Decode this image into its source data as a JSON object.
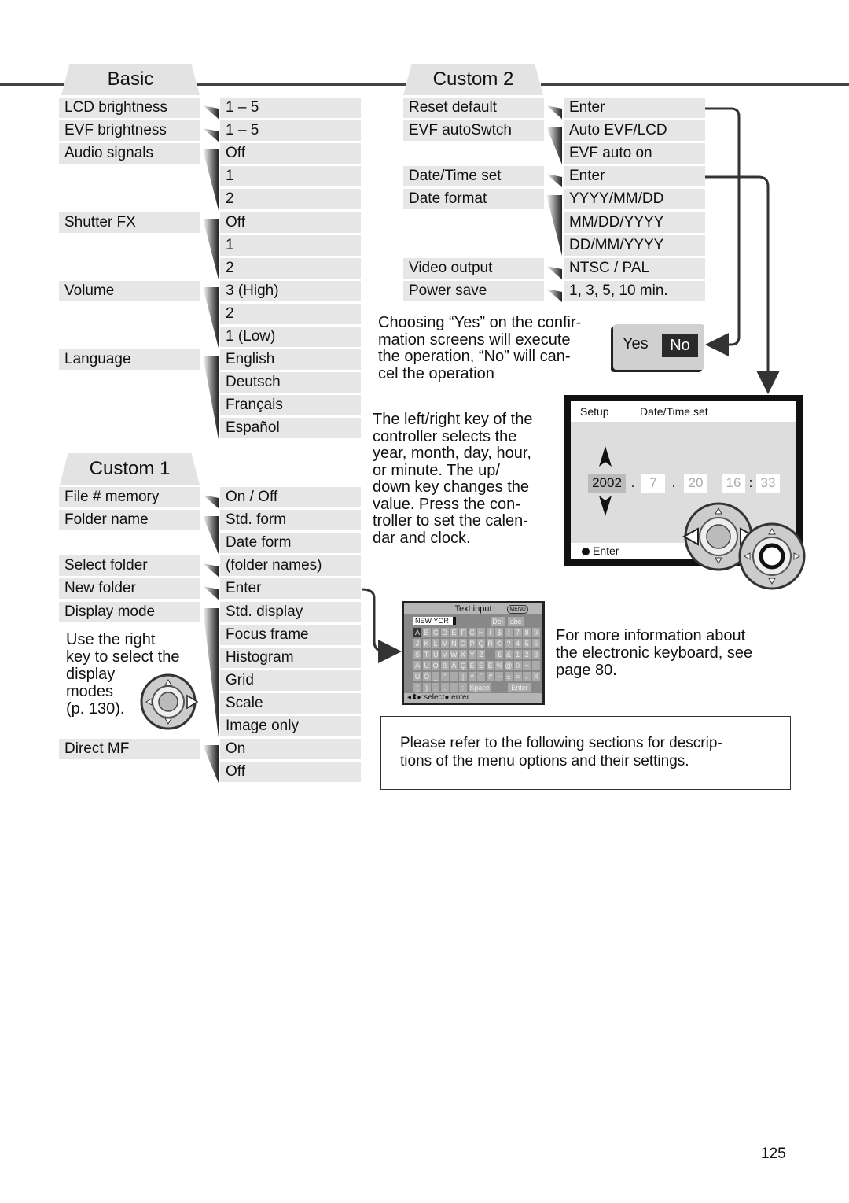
{
  "page_number": "125",
  "basic": {
    "title": "Basic",
    "groups": [
      {
        "label": "LCD brightness",
        "options": [
          "1 – 5"
        ]
      },
      {
        "label": "EVF brightness",
        "options": [
          "1 – 5"
        ]
      },
      {
        "label": "Audio signals",
        "options": [
          "Off",
          "1",
          "2"
        ]
      },
      {
        "label": "Shutter FX",
        "options": [
          "Off",
          "1",
          "2"
        ]
      },
      {
        "label": "Volume",
        "options": [
          "3 (High)",
          "2",
          "1 (Low)"
        ]
      },
      {
        "label": "Language",
        "options": [
          "English",
          "Deutsch",
          "Français",
          "Español"
        ]
      }
    ]
  },
  "custom1": {
    "title": "Custom 1",
    "groups": [
      {
        "label": "File # memory",
        "options": [
          "On / Off"
        ]
      },
      {
        "label": "Folder name",
        "options": [
          "Std. form",
          "Date form"
        ]
      },
      {
        "label": "Select folder",
        "options": [
          "(folder names)"
        ]
      },
      {
        "label": "New folder",
        "options": [
          "Enter"
        ]
      },
      {
        "label": "Display mode",
        "options": [
          "Std. display",
          "Focus frame",
          "Histogram",
          "Grid",
          "Scale",
          "Image only"
        ]
      },
      {
        "label": "Direct MF",
        "options": [
          "On",
          "Off"
        ]
      }
    ],
    "display_mode_note": "Use the right\nkey to select the\ndisplay\nmodes\n(p. 130)."
  },
  "custom2": {
    "title": "Custom 2",
    "groups": [
      {
        "label": "Reset default",
        "options": [
          "Enter"
        ]
      },
      {
        "label": "EVF autoSwtch",
        "options": [
          "Auto EVF/LCD",
          "EVF auto on"
        ]
      },
      {
        "label": "Date/Time set",
        "options": [
          "Enter"
        ]
      },
      {
        "label": "Date format",
        "options": [
          "YYYY/MM/DD",
          "MM/DD/YYYY",
          "DD/MM/YYYY"
        ]
      },
      {
        "label": "Video output",
        "options": [
          "NTSC / PAL"
        ]
      },
      {
        "label": "Power save",
        "options": [
          "1, 3, 5, 10 min."
        ]
      }
    ]
  },
  "confirm": {
    "text": "Choosing “Yes” on the confir-\nmation screens will execute\nthe operation, “No” will can-\ncel the operation",
    "yes_label": "Yes",
    "no_label": "No"
  },
  "datetime_text": "The left/right key of the\ncontroller selects the\nyear, month, day, hour,\nor minute. The up/\ndown key changes the\nvalue. Press the con-\ntroller to set the calen-\ndar and clock.",
  "datetime_screen": {
    "header_left": "Setup",
    "header_right": "Date/Time set",
    "year": "2002",
    "month": "7",
    "day": "20",
    "hour": "16",
    "minute": "33",
    "sep_dot": ".",
    "sep_colon": ":",
    "footer": "Enter"
  },
  "keyboard_screen": {
    "title": "Text input",
    "menu_label": "MENU",
    "input_value": "NEW YOR",
    "del_label": "Del",
    "abc_label": "abc",
    "rows": [
      [
        "A",
        "B",
        "C",
        "D",
        "E",
        "F",
        "G",
        "H",
        "I",
        "$",
        "!",
        "7",
        "8",
        "9"
      ],
      [
        "J",
        "K",
        "L",
        "M",
        "N",
        "O",
        "P",
        "Q",
        "R",
        "©",
        "?",
        "4",
        "5",
        "6"
      ],
      [
        "S",
        "T",
        "U",
        "V",
        "W",
        "X",
        "Y",
        "Z",
        "",
        "£",
        "&",
        "1",
        "2",
        "3"
      ],
      [
        "Ä",
        "Ü",
        "Ö",
        "ß",
        "Å",
        "Ç",
        "É",
        "È",
        "Ê",
        "%",
        "@",
        "0",
        "+",
        "-"
      ],
      [
        "Ù",
        "Ò",
        "_",
        "\"",
        "'",
        "|",
        "^",
        "`",
        "#",
        "~",
        "±",
        "=",
        "/",
        "X"
      ],
      [
        "(",
        ")",
        ",",
        ".",
        ";",
        ":"
      ]
    ],
    "space_label": "Space",
    "enter_label": "Enter",
    "footer": "◂⬍▸:select●:enter"
  },
  "keyboard_text": "For more information about\nthe electronic keyboard, see\npage 80.",
  "note": "Please refer to the following sections for descrip-\ntions of the menu options and their settings."
}
